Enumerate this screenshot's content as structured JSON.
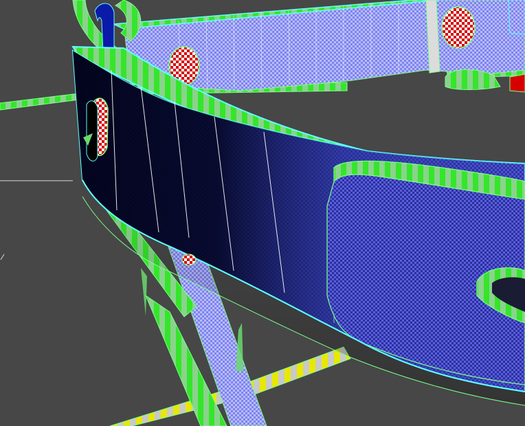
{
  "viewport": {
    "background_color": "#474747",
    "wireframe_color": "#7cff8a",
    "selection_color": "#5fffff",
    "uv_checker_primary": "#2b2f9e",
    "uv_checker_secondary": "#5a5fdb",
    "light_checker_primary": "#7e84e9",
    "light_checker_secondary": "#b7bbff",
    "dark_face_color": "#07072a",
    "marker_red": "#d60000",
    "marker_white": "#ffffff",
    "green_band_color": "#35e52b",
    "yellow_band_color": "#e8e800",
    "icons": {
      "rivet": "checker-disc-icon",
      "cable": "checker-tube-icon"
    }
  }
}
